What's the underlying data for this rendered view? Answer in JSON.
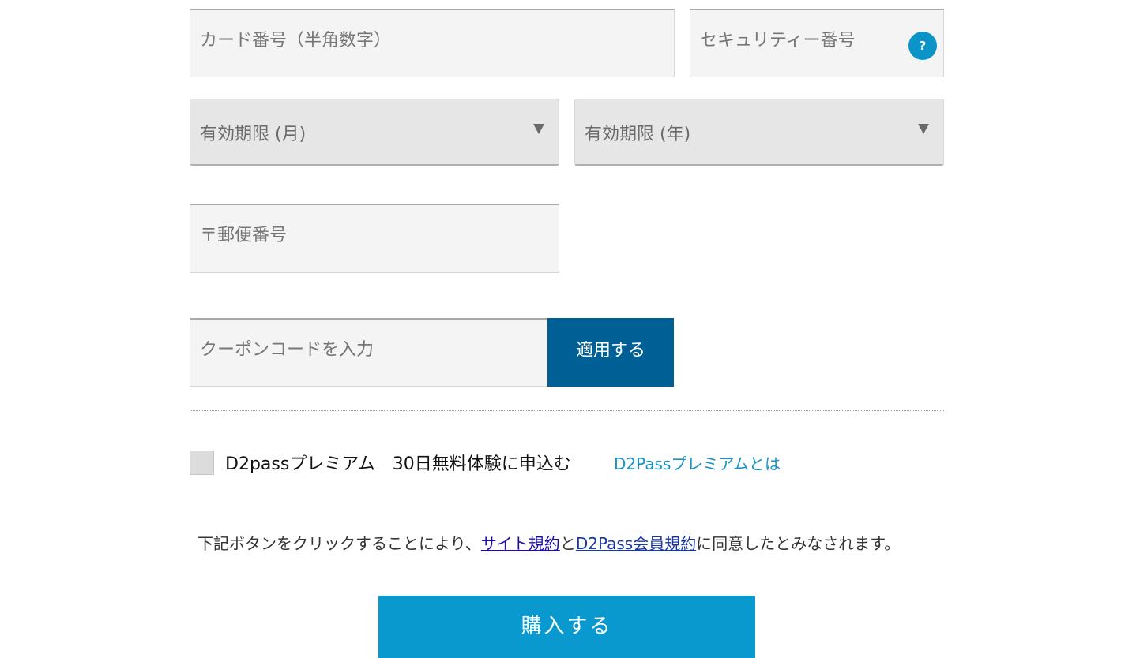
{
  "form": {
    "card_number": {
      "placeholder": "カード番号（半角数字）",
      "value": ""
    },
    "security_code": {
      "placeholder": "セキュリティー番号",
      "value": "",
      "help_icon": "?"
    },
    "exp_month": {
      "label": "有効期限 (月)"
    },
    "exp_year": {
      "label": "有効期限 (年)"
    },
    "postal_code": {
      "placeholder": "〒郵便番号",
      "value": ""
    },
    "coupon": {
      "placeholder": "クーポンコードを入力",
      "value": "",
      "apply_label": "適用する"
    }
  },
  "premium": {
    "checked": false,
    "label": "D2passプレミアム　30日無料体験に申込む",
    "link_label": "D2Passプレミアムとは"
  },
  "agreement": {
    "prefix": "下記ボタンをクリックすることにより、",
    "site_terms": "サイト規約",
    "and": "と",
    "member_terms": "D2Pass会員規約",
    "suffix": "に同意したとみなされます。"
  },
  "purchase_label": "購入する",
  "colors": {
    "apply_button": "#005f94",
    "purchase_button": "#0a99ce",
    "help_icon": "#0a94c7",
    "link": "#1793c8"
  }
}
